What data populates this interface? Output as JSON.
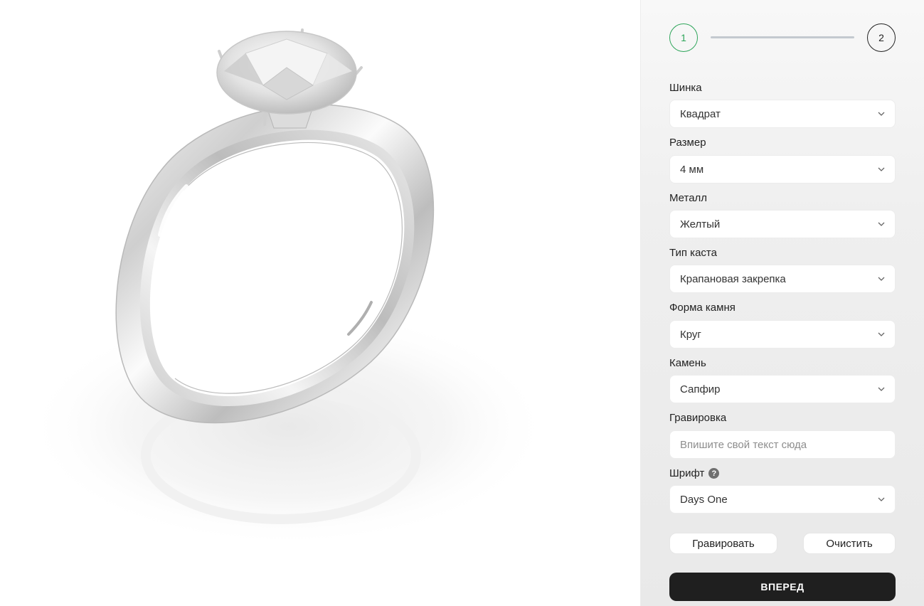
{
  "stepper": {
    "step1": "1",
    "step2": "2"
  },
  "form": {
    "fields": [
      {
        "label": "Шинка",
        "value": "Квадрат"
      },
      {
        "label": "Размер",
        "value": "4 мм"
      },
      {
        "label": "Металл",
        "value": "Желтый"
      },
      {
        "label": "Тип каста",
        "value": "Крапановая закрепка"
      },
      {
        "label": "Форма камня",
        "value": "Круг"
      },
      {
        "label": "Камень",
        "value": "Сапфир"
      }
    ],
    "engraving": {
      "label": "Гравировка",
      "placeholder": "Впишите свой текст сюда",
      "value": ""
    },
    "font": {
      "label": "Шрифт",
      "help": "?",
      "value": "Days One"
    }
  },
  "buttons": {
    "engrave": "Гравировать",
    "clear": "Очистить",
    "next": "ВПЕРЕД"
  },
  "colors": {
    "step_active": "#2ea55a",
    "primary_button": "#1f1f1f"
  }
}
